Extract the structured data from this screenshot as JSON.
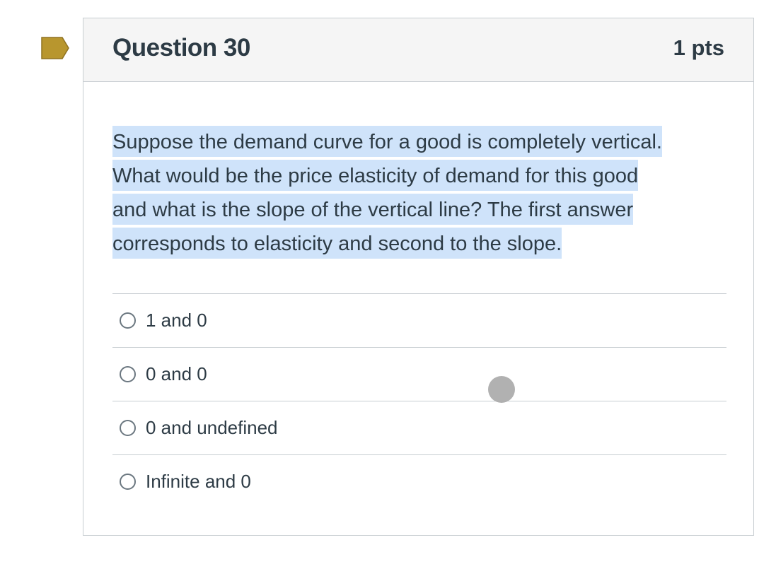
{
  "question": {
    "title": "Question 30",
    "points": "1 pts",
    "text_lines": [
      "Suppose the demand curve for a good is completely vertical.",
      "What would be the price elasticity of demand for this good",
      "and what is the slope of the vertical line? The first answer",
      "corresponds to elasticity and second to the slope."
    ]
  },
  "answers": [
    {
      "label": "1 and 0"
    },
    {
      "label": "0 and 0"
    },
    {
      "label": "0 and undefined"
    },
    {
      "label": "Infinite and 0"
    }
  ],
  "colors": {
    "flag": "#b8962e",
    "selection_highlight": "#cfe3fa",
    "text": "#2d3b45",
    "border": "#c7cdd1"
  }
}
